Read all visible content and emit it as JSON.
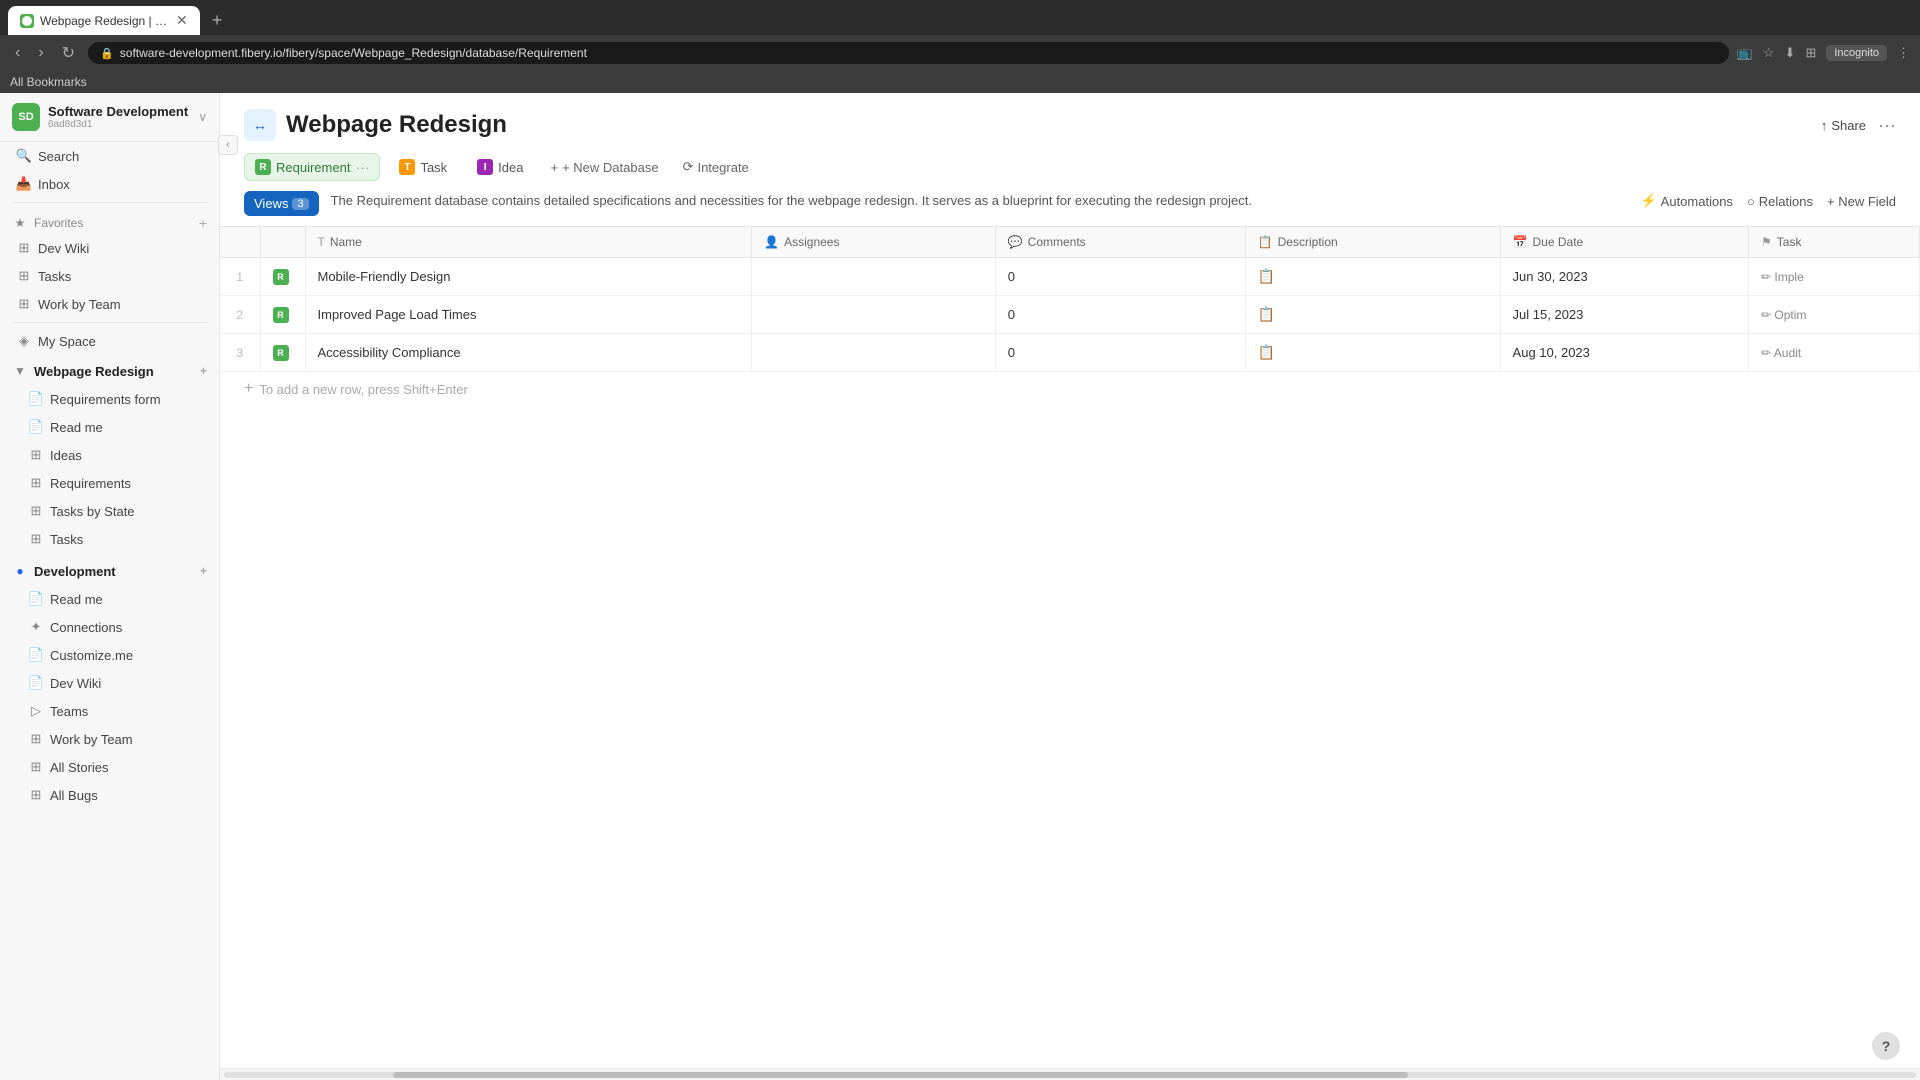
{
  "browser": {
    "tab_title": "Webpage Redesign | Fibery",
    "url": "software-development.fibery.io/fibery/space/Webpage_Redesign/database/Requirement",
    "new_tab_label": "+",
    "incognito_label": "Incognito",
    "bookmarks_label": "All Bookmarks"
  },
  "workspace": {
    "name": "Software Development",
    "id": "6ad8d3d1",
    "avatar_text": "SD"
  },
  "sidebar": {
    "search_label": "Search",
    "inbox_label": "Inbox",
    "favorites_label": "Favorites",
    "favorites_items": [
      {
        "label": "Dev Wiki",
        "icon": "grid"
      },
      {
        "label": "Tasks",
        "icon": "grid"
      },
      {
        "label": "Work by Team",
        "icon": "grid",
        "has_more": true
      }
    ],
    "my_space_label": "My Space",
    "webpage_redesign_label": "Webpage Redesign",
    "webpage_redesign_items": [
      {
        "label": "Requirements form",
        "icon": "doc"
      },
      {
        "label": "Read me",
        "icon": "doc"
      },
      {
        "label": "Ideas",
        "icon": "grid"
      },
      {
        "label": "Requirements",
        "icon": "grid"
      },
      {
        "label": "Tasks by State",
        "icon": "grid"
      },
      {
        "label": "Tasks",
        "icon": "grid"
      }
    ],
    "development_label": "Development",
    "development_items": [
      {
        "label": "Read me",
        "icon": "doc"
      },
      {
        "label": "Connections",
        "icon": "puzzle"
      },
      {
        "label": "Customize.me",
        "icon": "doc"
      },
      {
        "label": "Dev Wiki",
        "icon": "doc"
      },
      {
        "label": "Teams",
        "icon": "team"
      },
      {
        "label": "Work by Team",
        "icon": "grid"
      },
      {
        "label": "All Stories",
        "icon": "grid"
      },
      {
        "label": "All Bugs",
        "icon": "grid"
      }
    ]
  },
  "page": {
    "title": "Webpage Redesign",
    "icon_text": "↔",
    "share_label": "Share",
    "more_label": "···"
  },
  "db_tabs": [
    {
      "label": "Requirement",
      "icon": "R",
      "active": true,
      "color": "#4caf50"
    },
    {
      "label": "Task",
      "icon": "T",
      "active": false,
      "color": "#ff9800"
    },
    {
      "label": "Idea",
      "icon": "I",
      "active": false,
      "color": "#9c27b0"
    }
  ],
  "toolbar": {
    "new_db_label": "+ New Database",
    "integrate_label": "Integrate",
    "views_label": "Views",
    "views_count": "3",
    "description": "The Requirement database contains detailed specifications and necessities for the webpage redesign. It serves as a blueprint for executing the redesign project.",
    "automations_label": "Automations",
    "relations_label": "Relations",
    "new_field_label": "+ New Field"
  },
  "table": {
    "columns": [
      {
        "label": "",
        "type": "num"
      },
      {
        "label": "Name",
        "icon": "T"
      },
      {
        "label": "Assignees",
        "icon": "👤"
      },
      {
        "label": "Comments",
        "icon": "💬"
      },
      {
        "label": "Description",
        "icon": "📋"
      },
      {
        "label": "Due Date",
        "icon": "📅"
      },
      {
        "label": "Task",
        "icon": "⚑"
      }
    ],
    "rows": [
      {
        "num": 1,
        "name": "Mobile-Friendly Design",
        "assignees": "",
        "comments": "0",
        "description": "",
        "due_date": "Jun 30, 2023",
        "task": "Imple"
      },
      {
        "num": 2,
        "name": "Improved Page Load Times",
        "assignees": "",
        "comments": "0",
        "description": "",
        "due_date": "Jul 15, 2023",
        "task": "Optim"
      },
      {
        "num": 3,
        "name": "Accessibility Compliance",
        "assignees": "",
        "comments": "0",
        "description": "",
        "due_date": "Aug 10, 2023",
        "task": "Audit"
      }
    ],
    "add_row_placeholder": "To add a new row, press Shift+Enter"
  },
  "help": {
    "label": "?"
  }
}
